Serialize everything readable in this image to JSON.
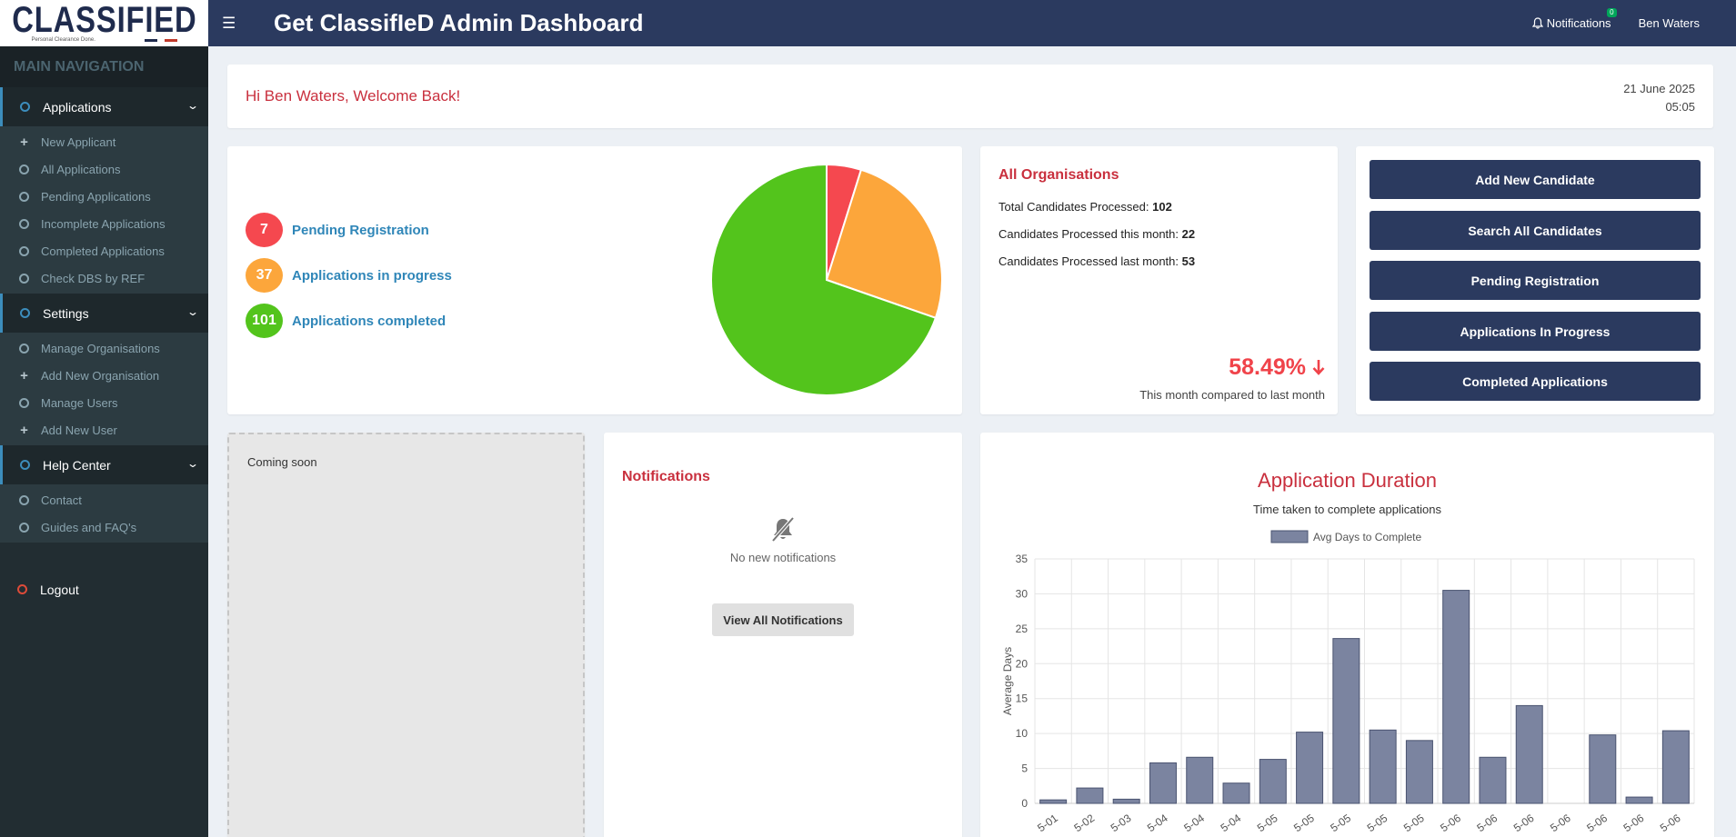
{
  "logo": {
    "wordmark": "CLASSIFIED",
    "tagline": "Personal Clearance Done."
  },
  "topbar": {
    "title": "Get ClassifIeD Admin Dashboard",
    "notifications_label": "Notifications",
    "notifications_count": "0",
    "user": "Ben Waters"
  },
  "sidebar": {
    "header": "MAIN NAVIGATION",
    "groups": [
      {
        "label": "Applications",
        "items": [
          {
            "label": "New Applicant",
            "icon": "plus-icon"
          },
          {
            "label": "All Applications",
            "icon": "circle-icon"
          },
          {
            "label": "Pending Applications",
            "icon": "circle-icon"
          },
          {
            "label": "Incomplete Applications",
            "icon": "circle-icon"
          },
          {
            "label": "Completed Applications",
            "icon": "circle-icon"
          },
          {
            "label": "Check DBS by REF",
            "icon": "circle-icon"
          }
        ]
      },
      {
        "label": "Settings",
        "items": [
          {
            "label": "Manage Organisations",
            "icon": "circle-icon"
          },
          {
            "label": "Add New Organisation",
            "icon": "plus-icon"
          },
          {
            "label": "Manage Users",
            "icon": "circle-icon"
          },
          {
            "label": "Add New User",
            "icon": "plus-icon"
          }
        ]
      },
      {
        "label": "Help Center",
        "items": [
          {
            "label": "Contact",
            "icon": "circle-icon"
          },
          {
            "label": "Guides and FAQ's",
            "icon": "circle-icon"
          }
        ]
      }
    ],
    "logout": "Logout"
  },
  "welcome": {
    "message": "Hi Ben Waters, Welcome Back!",
    "date": "21 June 2025",
    "time": "05:05"
  },
  "stats": [
    {
      "value": "7",
      "label": "Pending Registration",
      "color": "#f5484f"
    },
    {
      "value": "37",
      "label": "Applications in progress",
      "color": "#fca63b"
    },
    {
      "value": "101",
      "label": "Applications completed",
      "color": "#53c41c"
    }
  ],
  "organisations": {
    "title": "All Organisations",
    "lines": [
      {
        "label": "Total Candidates Processed: ",
        "value": "102"
      },
      {
        "label": "Candidates Processed this month: ",
        "value": "22"
      },
      {
        "label": "Candidates Processed last month: ",
        "value": "53"
      }
    ],
    "change": "58.49%",
    "change_note": "This month compared to last month"
  },
  "actions": [
    "Add New Candidate",
    "Search All Candidates",
    "Pending Registration",
    "Applications In Progress",
    "Completed Applications"
  ],
  "coming_soon": "Coming soon",
  "notifications": {
    "title": "Notifications",
    "empty": "No new notifications",
    "button": "View All Notifications"
  },
  "duration": {
    "title": "Application Duration",
    "subtitle": "Time taken to complete applications"
  },
  "chart_data": {
    "type": "bar",
    "title": "Application Duration",
    "ylabel": "Average Days",
    "ylim": [
      0,
      35
    ],
    "yticks": [
      0,
      5,
      10,
      15,
      20,
      25,
      30,
      35
    ],
    "series": [
      {
        "name": "Avg Days to Complete",
        "color": "#7b84a0",
        "values": [
          0.5,
          2.2,
          0.6,
          5.8,
          6.6,
          2.9,
          6.3,
          10.2,
          23.6,
          10.5,
          9.0,
          30.5,
          6.6,
          14.0,
          0,
          9.8,
          0.9,
          10.4
        ]
      }
    ],
    "categories": [
      "5-01",
      "5-02",
      "5-03",
      "5-04",
      "5-04",
      "5-04",
      "5-05",
      "5-05",
      "5-05",
      "5-05",
      "5-05",
      "5-06",
      "5-06",
      "5-06",
      "5-06",
      "5-06",
      "5-06",
      "5-06"
    ]
  }
}
